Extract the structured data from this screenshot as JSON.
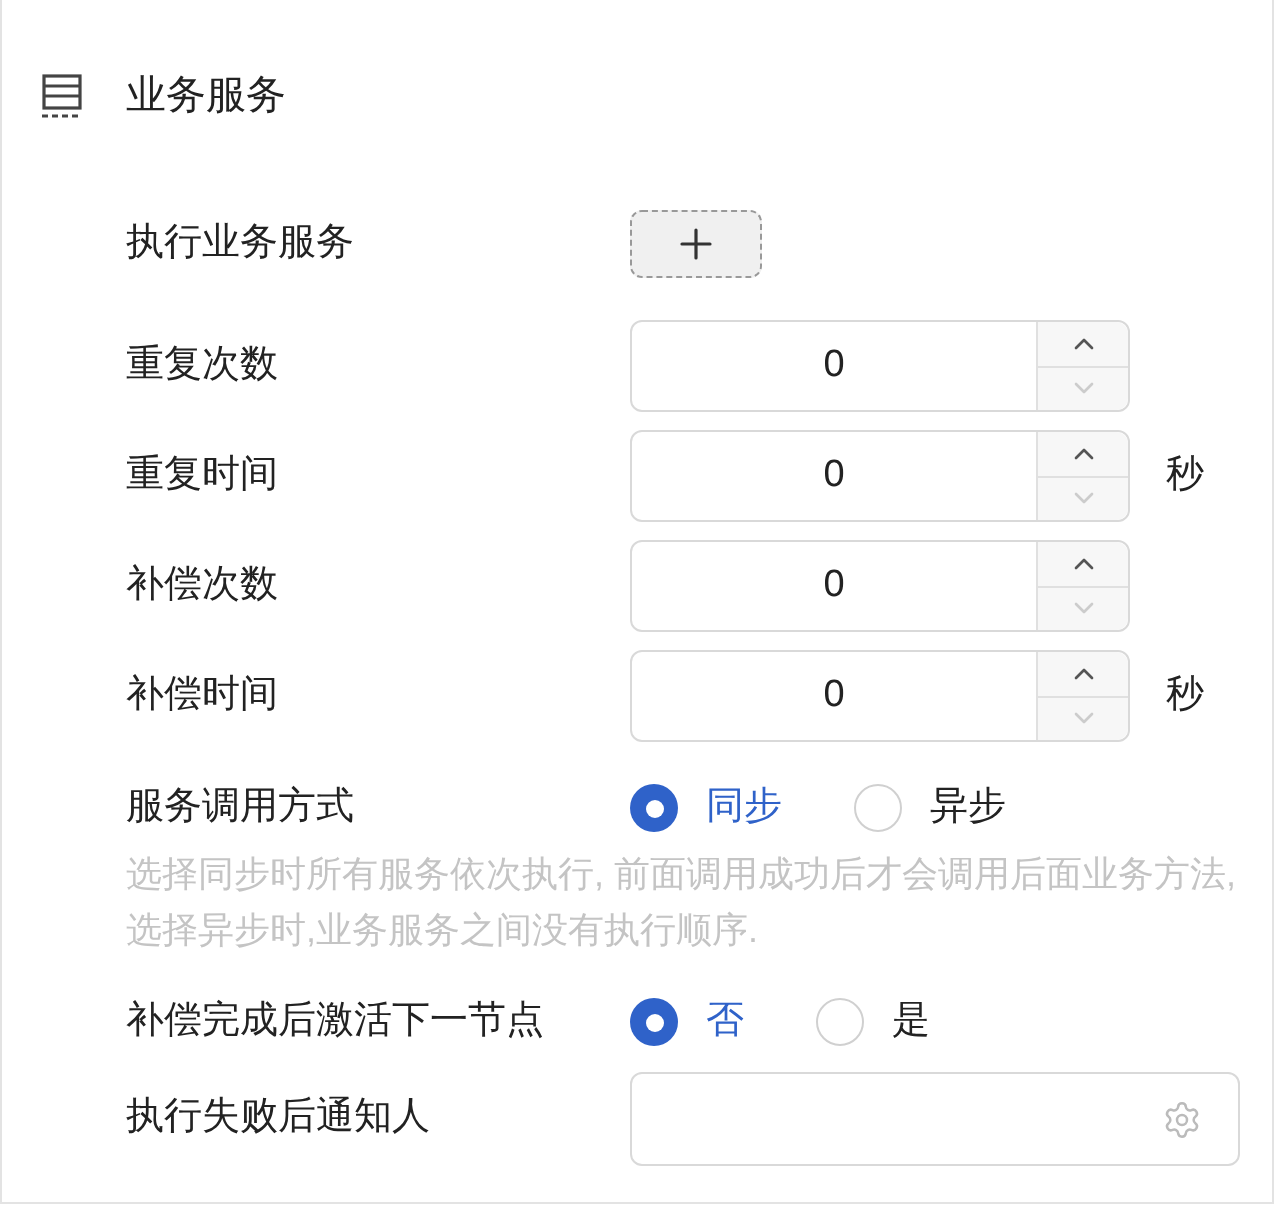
{
  "section": {
    "title": "业务服务"
  },
  "fields": [
    {
      "kind": "add",
      "label": "执行业务服务"
    },
    {
      "kind": "number",
      "label": "重复次数",
      "value": "0"
    },
    {
      "kind": "number",
      "label": "重复时间",
      "value": "0",
      "unit": "秒"
    },
    {
      "kind": "number",
      "label": "补偿次数",
      "value": "0"
    },
    {
      "kind": "number",
      "label": "补偿时间",
      "value": "0",
      "unit": "秒"
    },
    {
      "kind": "radio",
      "label": "服务调用方式",
      "options": [
        {
          "label": "同步",
          "selected": true
        },
        {
          "label": "异步",
          "selected": false
        }
      ],
      "hint": "选择同步时所有服务依次执行, 前面调用成功后才会调用后面业务方法, 选择异步时,业务服务之间没有执行顺序."
    },
    {
      "kind": "radio",
      "label": "补偿完成后激活下一节点",
      "options": [
        {
          "label": "否",
          "selected": true
        },
        {
          "label": "是",
          "selected": false
        }
      ]
    },
    {
      "kind": "picker",
      "label": "执行失败后通知人"
    }
  ]
}
